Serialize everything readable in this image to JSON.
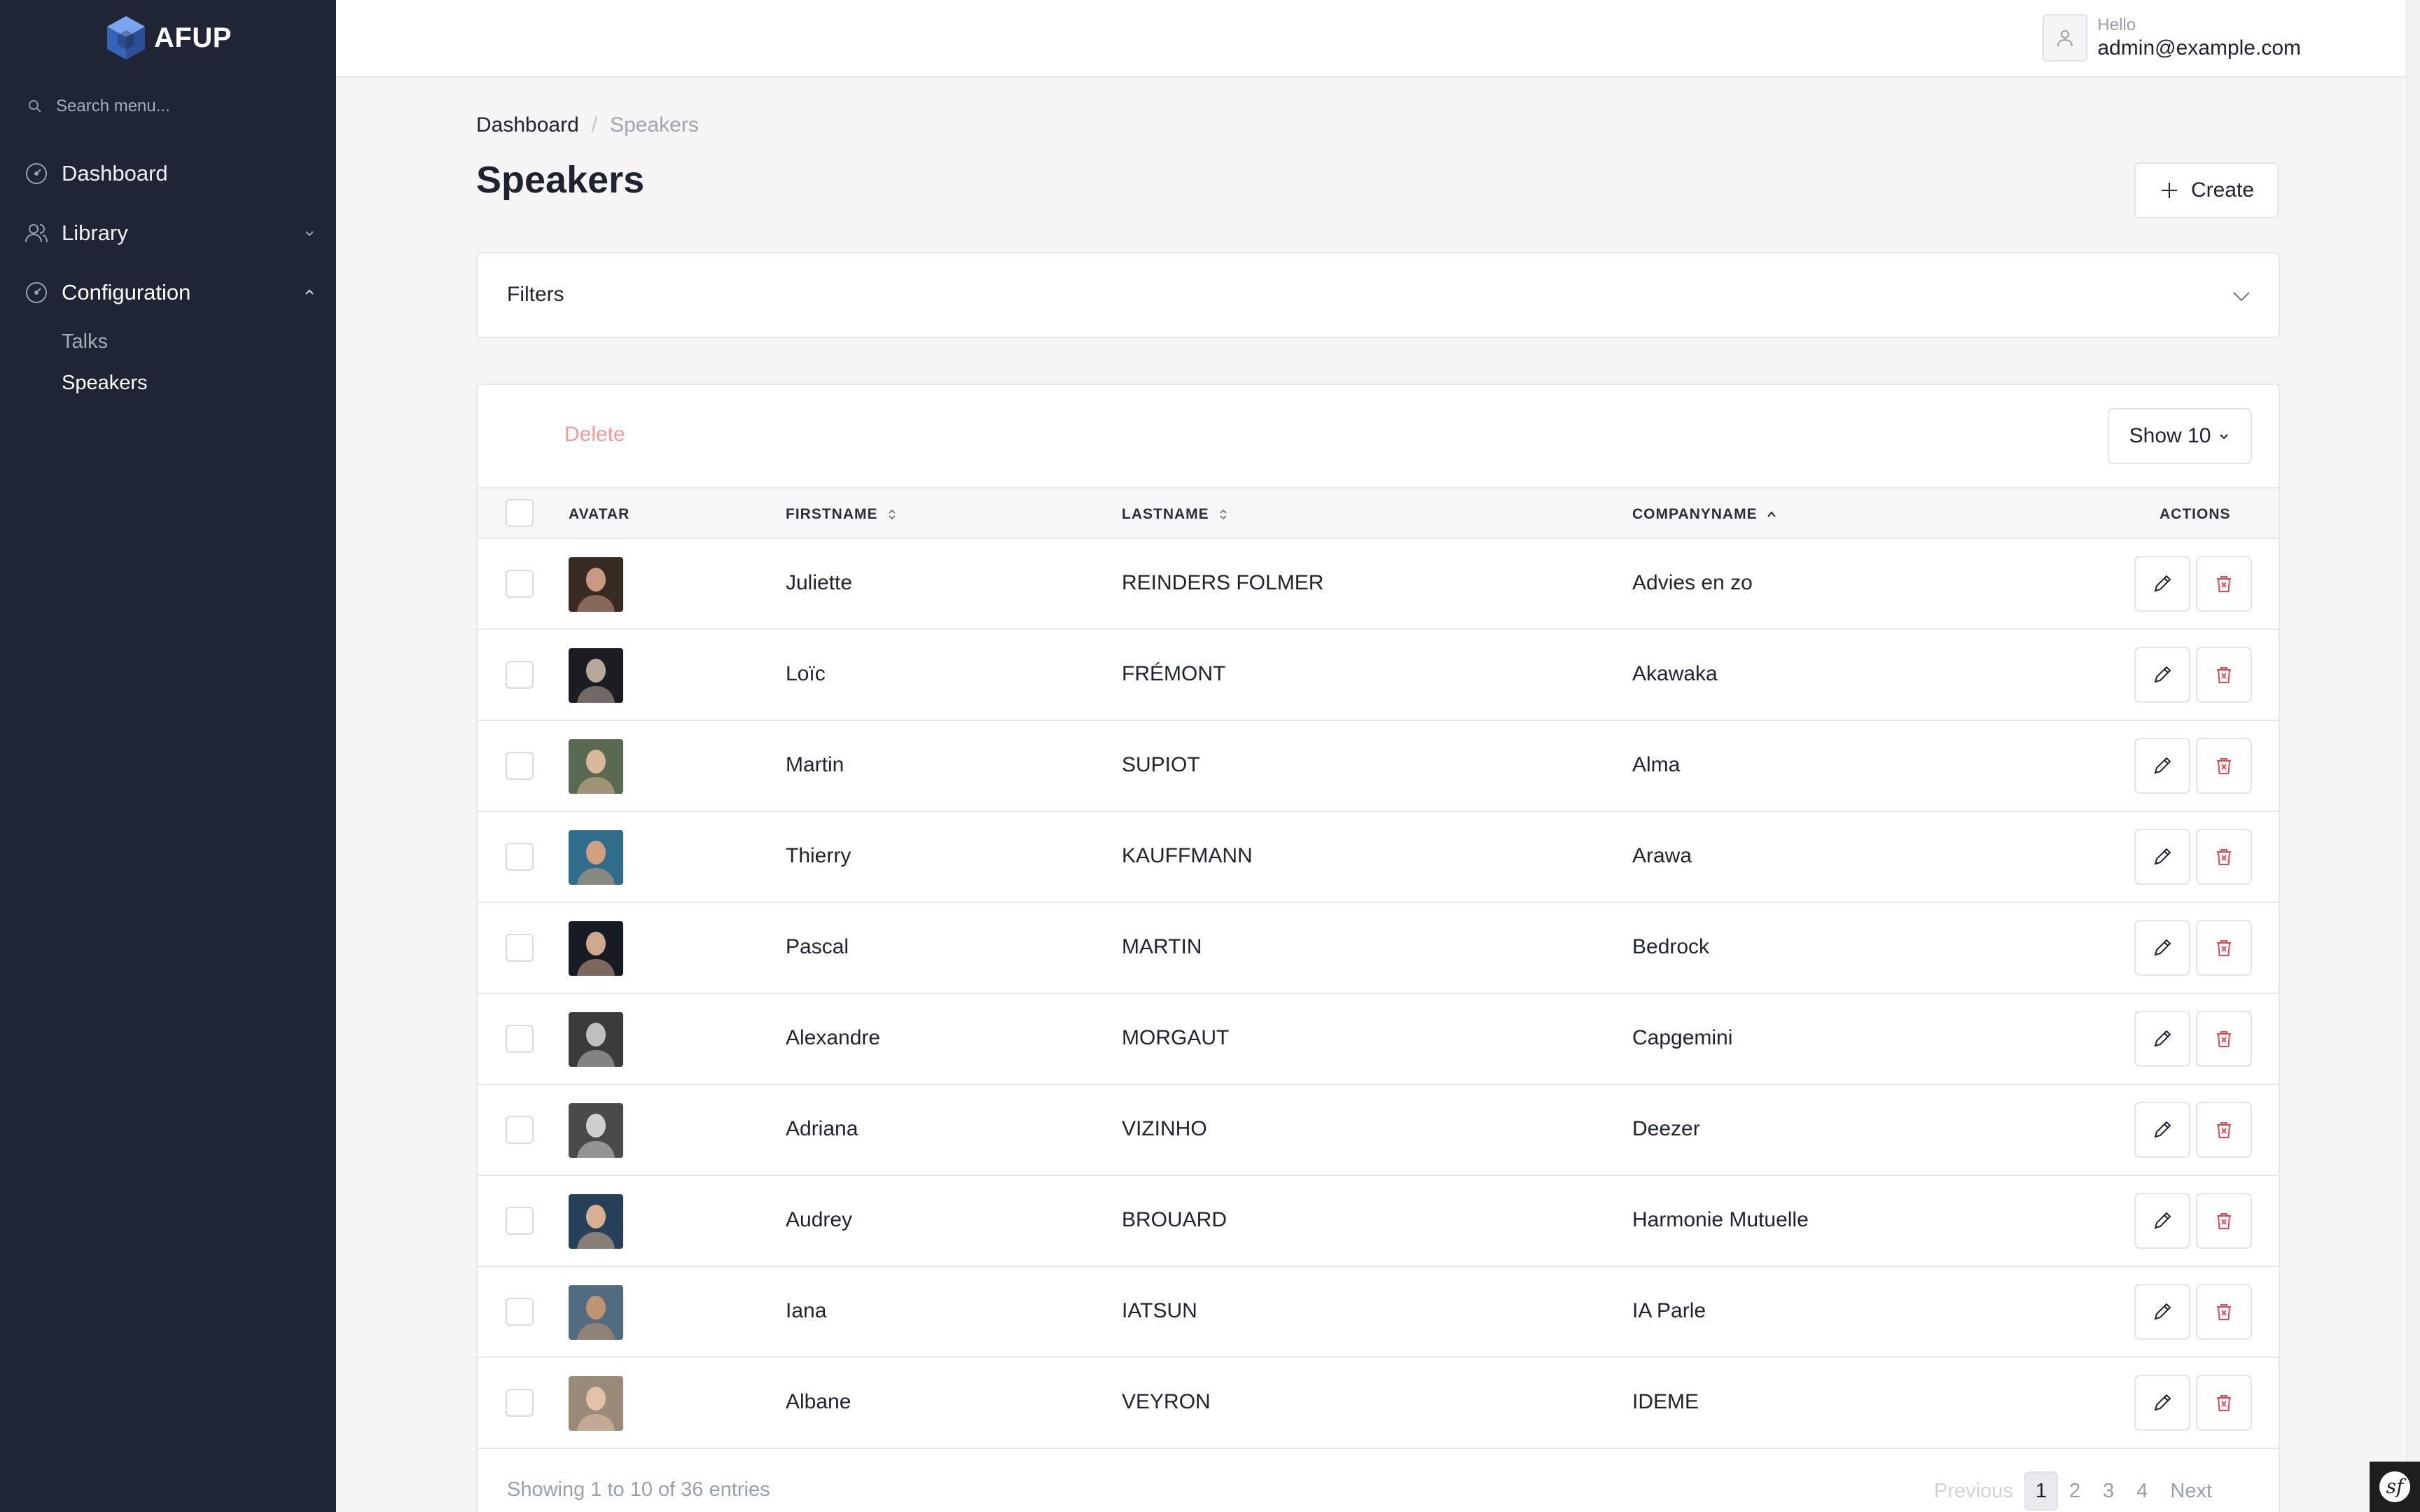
{
  "app": {
    "brand_name": "AFUP",
    "logo_icon": "hexagon-cube-logo",
    "accent_color": "#3b82f6"
  },
  "sidebar": {
    "search_placeholder": "Search menu...",
    "items": [
      {
        "label": "Dashboard",
        "icon": "gauge-icon"
      },
      {
        "label": "Library",
        "icon": "users-icon",
        "expanded": false
      },
      {
        "label": "Configuration",
        "icon": "gauge-icon",
        "expanded": true
      }
    ],
    "sub_items": [
      {
        "label": "Talks"
      },
      {
        "label": "Speakers"
      }
    ]
  },
  "header": {
    "greeting": "Hello",
    "user_email": "admin@example.com"
  },
  "breadcrumb": {
    "root": "Dashboard",
    "current": "Speakers"
  },
  "page": {
    "title": "Speakers",
    "create_label": "Create",
    "filters_label": "Filters"
  },
  "table": {
    "delete_label": "Delete",
    "page_size_label": "Show 10",
    "columns": {
      "avatar": "AVATAR",
      "firstname": "FIRSTNAME",
      "lastname": "LASTNAME",
      "companyname": "COMPANYNAME",
      "actions": "ACTIONS"
    },
    "rows": [
      {
        "firstname": "Juliette",
        "lastname": "REINDERS FOLMER",
        "company": "Advies en zo"
      },
      {
        "firstname": "Loïc",
        "lastname": "FRÉMONT",
        "company": "Akawaka"
      },
      {
        "firstname": "Martin",
        "lastname": "SUPIOT",
        "company": "Alma"
      },
      {
        "firstname": "Thierry",
        "lastname": "KAUFFMANN",
        "company": "Arawa"
      },
      {
        "firstname": "Pascal",
        "lastname": "MARTIN",
        "company": "Bedrock"
      },
      {
        "firstname": "Alexandre",
        "lastname": "MORGAUT",
        "company": "Capgemini"
      },
      {
        "firstname": "Adriana",
        "lastname": "VIZINHO",
        "company": "Deezer"
      },
      {
        "firstname": "Audrey",
        "lastname": "BROUARD",
        "company": "Harmonie Mutuelle"
      },
      {
        "firstname": "Iana",
        "lastname": "IATSUN",
        "company": "IA Parle"
      },
      {
        "firstname": "Albane",
        "lastname": "VEYRON",
        "company": "IDEME"
      }
    ],
    "footer_info": "Showing 1 to 10 of 36 entries",
    "pagination": {
      "previous": "Previous",
      "pages": [
        "1",
        "2",
        "3",
        "4"
      ],
      "active_page": "1",
      "next": "Next"
    }
  }
}
